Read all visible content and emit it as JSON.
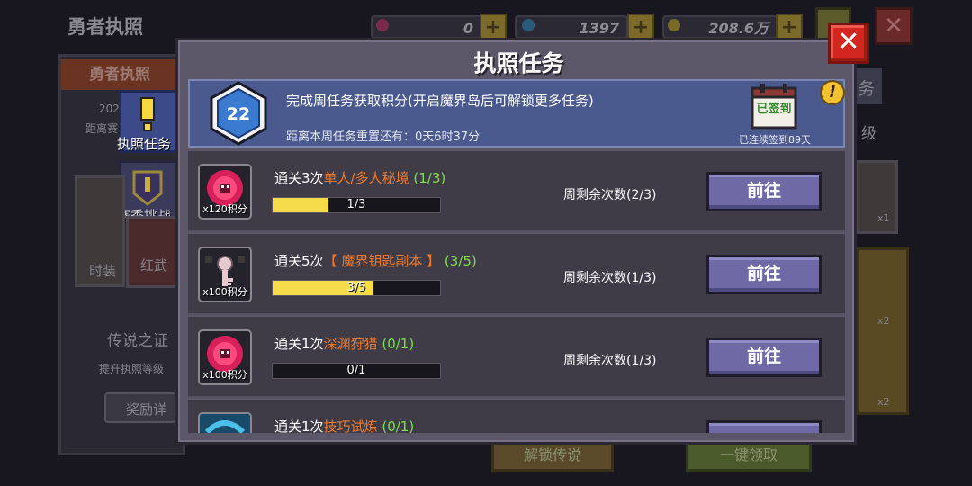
{
  "background": {
    "screen_title": "勇者执照",
    "currencies": [
      {
        "value": "0",
        "gem_color": "#c8407a"
      },
      {
        "value": "1397",
        "gem_color": "#3aa8d8"
      },
      {
        "value": "208.6万",
        "gem_color": "#e8c040"
      }
    ],
    "banner": "勇者执照",
    "side_tabs": [
      "执照任务",
      "赛季挑战"
    ],
    "tiles": [
      "时装",
      "红武"
    ],
    "legend_title": "传说之证",
    "legend_desc": "提升执照等级",
    "reward_detail": "奖励详",
    "right_text": [
      "务",
      "级"
    ],
    "item_counts": [
      "x1",
      "x2",
      "x2"
    ],
    "bottom_buttons": [
      "解锁传说",
      "一键领取"
    ],
    "small_texts": [
      "202",
      "距离赛"
    ]
  },
  "dialog": {
    "title": "执照任务",
    "close_label": "✕",
    "weekly": {
      "level": "22",
      "description": "完成周任务获取积分(开启魔界岛后可解锁更多任务)",
      "reset_timer": "距离本周任务重置还有：0天6时37分",
      "signed_label": "已签到",
      "streak": "已连续签到89天",
      "alert": "!"
    },
    "tasks": [
      {
        "prefix": "通关3次",
        "target": "单人/多人秘境",
        "count": "(1/3)",
        "progress_text": "1/3",
        "progress": 0.333,
        "remaining": "周剩余次数(2/3)",
        "reward": "x120积分",
        "button": "前往",
        "icon": "monster-portal-icon"
      },
      {
        "prefix": "通关5次",
        "target": "【 魔界钥匙副本 】",
        "count": "(3/5)",
        "progress_text": "3/5",
        "progress": 0.6,
        "remaining": "周剩余次数(1/3)",
        "reward": "x100积分",
        "button": "前往",
        "icon": "key-icon"
      },
      {
        "prefix": "通关1次",
        "target": "深渊狩猎",
        "count": "(0/1)",
        "progress_text": "0/1",
        "progress": 0,
        "remaining": "周剩余次数(1/3)",
        "reward": "x100积分",
        "button": "前往",
        "icon": "monster-portal-icon"
      },
      {
        "prefix": "通关1次",
        "target": "技巧试炼",
        "count": "(0/1)",
        "progress_text": "",
        "progress": 0,
        "remaining": "",
        "reward": "",
        "button": "",
        "icon": "skill-trial-icon"
      }
    ]
  },
  "colors": {
    "highlight": "#f07a2a",
    "count_green": "#7ae04a",
    "progress_fill": "#f6dc48",
    "go_button": "#6f6aa6",
    "close_red": "#d3261f"
  }
}
